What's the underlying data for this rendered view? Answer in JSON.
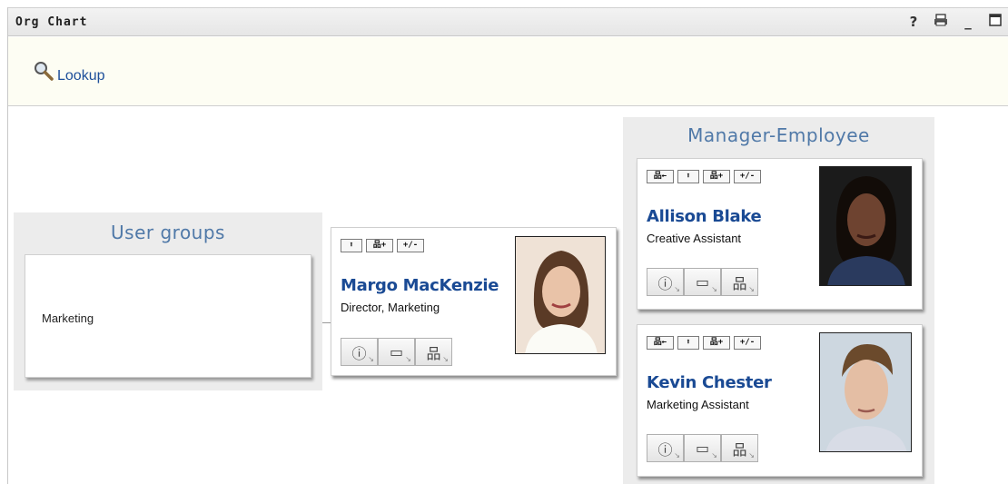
{
  "window": {
    "title": "Org Chart",
    "icons": [
      "help-icon",
      "print-icon",
      "minimize-icon",
      "maximize-icon"
    ],
    "help_glyph": "?",
    "minimize_glyph": "_"
  },
  "lookup": {
    "label": "Lookup",
    "icon": "magnifier-icon"
  },
  "user_groups": {
    "title": "User groups",
    "items": [
      "Marketing"
    ]
  },
  "focus_person": {
    "name": "Margo MacKenzie",
    "job_title": "Director, Marketing",
    "buttons": [
      "↑",
      "🗗+",
      "+/−"
    ]
  },
  "manager_employee": {
    "title": "Manager-Employee",
    "people": [
      {
        "name": "Allison Blake",
        "job_title": "Creative Assistant"
      },
      {
        "name": "Kevin Chester",
        "job_title": "Marketing Assistant"
      }
    ]
  },
  "card_buttons": {
    "move_up": "⬆",
    "expand": "品+",
    "toggle": "+/-",
    "set_root": "品←"
  },
  "action_icons": {
    "info": "ⓘ",
    "email": "▭",
    "orgchart": "品",
    "arrow": "↘"
  },
  "colors": {
    "accent": "#1a4a94",
    "panel_title": "#5079a8",
    "panel_bg": "#ececec"
  }
}
